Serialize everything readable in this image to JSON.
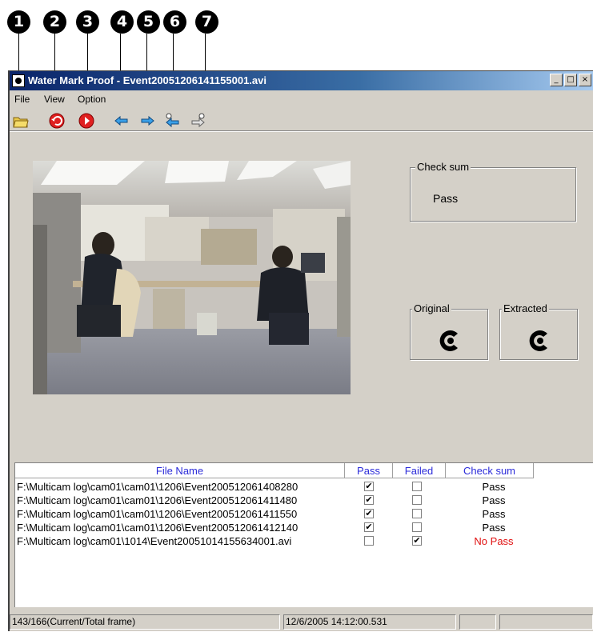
{
  "callouts": [
    "1",
    "2",
    "3",
    "4",
    "5",
    "6",
    "7"
  ],
  "window": {
    "title": "Water Mark Proof - Event20051206141155001.avi",
    "controls": {
      "minimize": "_",
      "maximize": "□",
      "close": "×"
    }
  },
  "menu": {
    "file": "File",
    "view": "View",
    "option": "Option"
  },
  "toolbar": {
    "buttons": [
      {
        "icon": "open-folder-icon"
      },
      {
        "icon": "rewind-icon"
      },
      {
        "icon": "play-icon"
      },
      {
        "icon": "previous-frame-icon"
      },
      {
        "icon": "next-frame-icon"
      },
      {
        "icon": "previous-file-icon"
      },
      {
        "icon": "next-file-icon"
      }
    ]
  },
  "checksum": {
    "label": "Check sum",
    "value": "Pass"
  },
  "watermark": {
    "original_label": "Original",
    "extracted_label": "Extracted"
  },
  "filelist": {
    "columns": [
      "File Name",
      "Pass",
      "Failed",
      "Check sum"
    ],
    "rows": [
      {
        "file": "F:\\Multicam log\\cam01\\cam01\\1206\\Event200512061408280",
        "pass": true,
        "failed": false,
        "checksum": "Pass"
      },
      {
        "file": "F:\\Multicam log\\cam01\\cam01\\1206\\Event200512061411480",
        "pass": true,
        "failed": false,
        "checksum": "Pass"
      },
      {
        "file": "F:\\Multicam log\\cam01\\cam01\\1206\\Event200512061411550",
        "pass": true,
        "failed": false,
        "checksum": "Pass"
      },
      {
        "file": "F:\\Multicam log\\cam01\\cam01\\1206\\Event200512061412140",
        "pass": true,
        "failed": false,
        "checksum": "Pass"
      },
      {
        "file": "F:\\Multicam log\\cam01\\1014\\Event20051014155634001.avi",
        "pass": false,
        "failed": true,
        "checksum": "No Pass"
      }
    ]
  },
  "status": {
    "frame": "143/166(Current/Total frame)",
    "timestamp": "12/6/2005 14:12:00.531"
  },
  "colors": {
    "header_text": "#2b2bd9",
    "fail_text": "#e01010",
    "pass_text": "#000000"
  }
}
